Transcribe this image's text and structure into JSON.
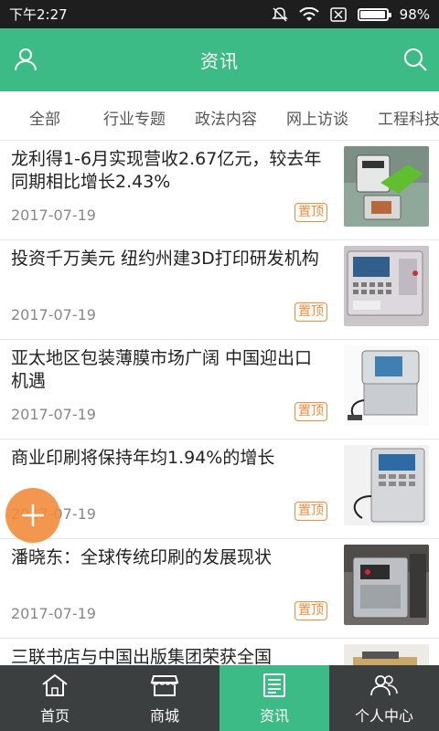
{
  "status_bar": {
    "time": "下午2:27",
    "battery": "98%"
  },
  "header": {
    "title": "资讯",
    "left_icon": "user-icon",
    "right_icon": "search-icon"
  },
  "tabs": [
    {
      "label": "全部"
    },
    {
      "label": "行业专题"
    },
    {
      "label": "政法内容"
    },
    {
      "label": "网上访谈"
    },
    {
      "label": "工程科技"
    }
  ],
  "news": [
    {
      "headline": "龙利得1-6月实现营收2.67亿元，较去年同期相比增长2.43%",
      "date": "2017-07-19",
      "badge": "置顶"
    },
    {
      "headline": "投资千万美元 纽约州建3D打印研发机构",
      "date": "2017-07-19",
      "badge": "置顶"
    },
    {
      "headline": "亚太地区包装薄膜市场广阔 中国迎出口机遇",
      "date": "2017-07-19",
      "badge": "置顶"
    },
    {
      "headline": "商业印刷将保持年均1.94%的增长",
      "date": "2017-07-19",
      "badge": "置顶"
    },
    {
      "headline": "潘晓东：全球传统印刷的发展现状",
      "date": "2017-07-19",
      "badge": "置顶"
    },
    {
      "headline": "三联书店与中国出版集团荣获全国",
      "date": "",
      "badge": ""
    }
  ],
  "bottom_nav": [
    {
      "label": "首页",
      "icon": "home-icon",
      "active": false
    },
    {
      "label": "商城",
      "icon": "shop-icon",
      "active": false
    },
    {
      "label": "资讯",
      "icon": "news-icon",
      "active": true
    },
    {
      "label": "个人中心",
      "icon": "people-icon",
      "active": false
    }
  ],
  "colors": {
    "accent": "#3dbb86",
    "badge": "#f08c3c",
    "nav_bg": "#3b3f3f"
  }
}
